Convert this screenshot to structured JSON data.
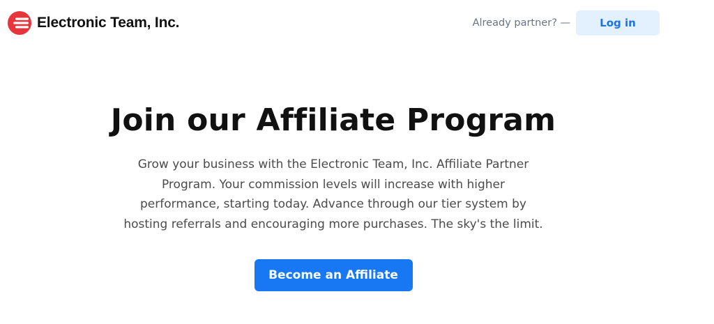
{
  "header": {
    "logo_icon": "electronic-team-logo-icon",
    "brand_name": "Electronic Team, Inc.",
    "already_partner_text": "Already partner? —",
    "login_label": "Log in"
  },
  "hero": {
    "title": "Join our Affiliate Program",
    "description": "Grow your business with the Electronic Team, Inc. Affiliate Partner Program. Your commission levels will increase with higher performance, starting today. Advance through our tier system by hosting referrals and encouraging more purchases. The sky's the limit.",
    "cta_label": "Become an Affiliate"
  },
  "colors": {
    "brand_red": "#e8343b",
    "accent_blue": "#1877f2",
    "login_bg": "#e3f0fd",
    "login_text": "#1a73e8",
    "title_text": "#111111",
    "body_text": "#4b4b4b",
    "muted_text": "#6b7280"
  }
}
